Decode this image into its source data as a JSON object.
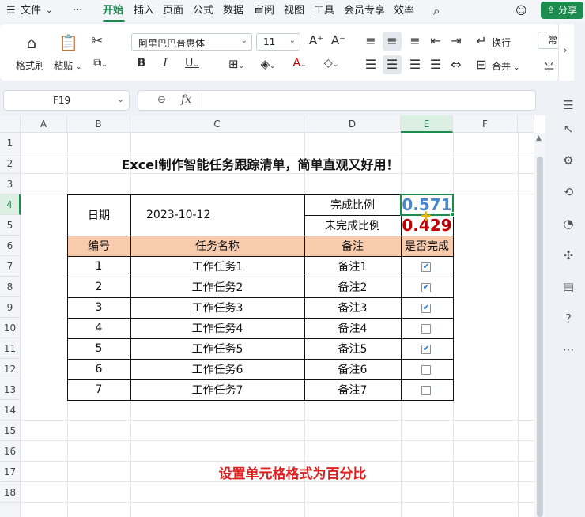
{
  "menubar": {
    "menu_icon": "hamburger-icon",
    "file_label": "文件",
    "more_label": "···",
    "tabs": [
      "开始",
      "插入",
      "页面",
      "公式",
      "数据",
      "审阅",
      "视图",
      "工具",
      "会员专享",
      "效率"
    ],
    "share_label": "分享"
  },
  "ribbon": {
    "format_painter_label": "格式刷",
    "paste_label": "粘贴",
    "font_name": "阿里巴巴普惠体",
    "font_size": "11",
    "wrap_label": "换行",
    "merge_label": "合并",
    "number_format_label": "常",
    "currency_symbol": "半"
  },
  "formula": {
    "cell_ref": "F19",
    "fx_label": "fx",
    "content": ""
  },
  "sheet": {
    "columns": [
      "A",
      "B",
      "C",
      "D",
      "E",
      "F"
    ],
    "selected_column": "E",
    "rows": [
      "1",
      "2",
      "3",
      "4",
      "5",
      "6",
      "7",
      "8",
      "9",
      "10",
      "11",
      "12",
      "13",
      "14",
      "15",
      "16",
      "17",
      "18"
    ],
    "selected_row": "4",
    "title": "Excel制作智能任务跟踪清单，简单直观又好用！",
    "date_label": "日期",
    "date_value": "2023-10-12",
    "done_ratio_label": "完成比例",
    "done_ratio_value": "0.571",
    "undone_ratio_label": "未完成比例",
    "undone_ratio_value": "0.429",
    "headers": [
      "编号",
      "任务名称",
      "备注",
      "是否完成"
    ],
    "tasks": [
      {
        "no": "1",
        "name": "工作任务1",
        "note": "备注1",
        "done": true
      },
      {
        "no": "2",
        "name": "工作任务2",
        "note": "备注2",
        "done": true
      },
      {
        "no": "3",
        "name": "工作任务3",
        "note": "备注3",
        "done": true
      },
      {
        "no": "4",
        "name": "工作任务4",
        "note": "备注4",
        "done": false
      },
      {
        "no": "5",
        "name": "工作任务5",
        "note": "备注5",
        "done": true
      },
      {
        "no": "6",
        "name": "工作任务6",
        "note": "备注6",
        "done": false
      },
      {
        "no": "7",
        "name": "工作任务7",
        "note": "备注7",
        "done": false
      }
    ],
    "caption": "设置单元格格式为百分比"
  },
  "colors": {
    "accent": "#1c8d4f",
    "header_fill": "#f8cbad",
    "done_ratio_color": "#4a86c8",
    "undone_ratio_color": "#c00000",
    "caption_color": "#e02020"
  }
}
